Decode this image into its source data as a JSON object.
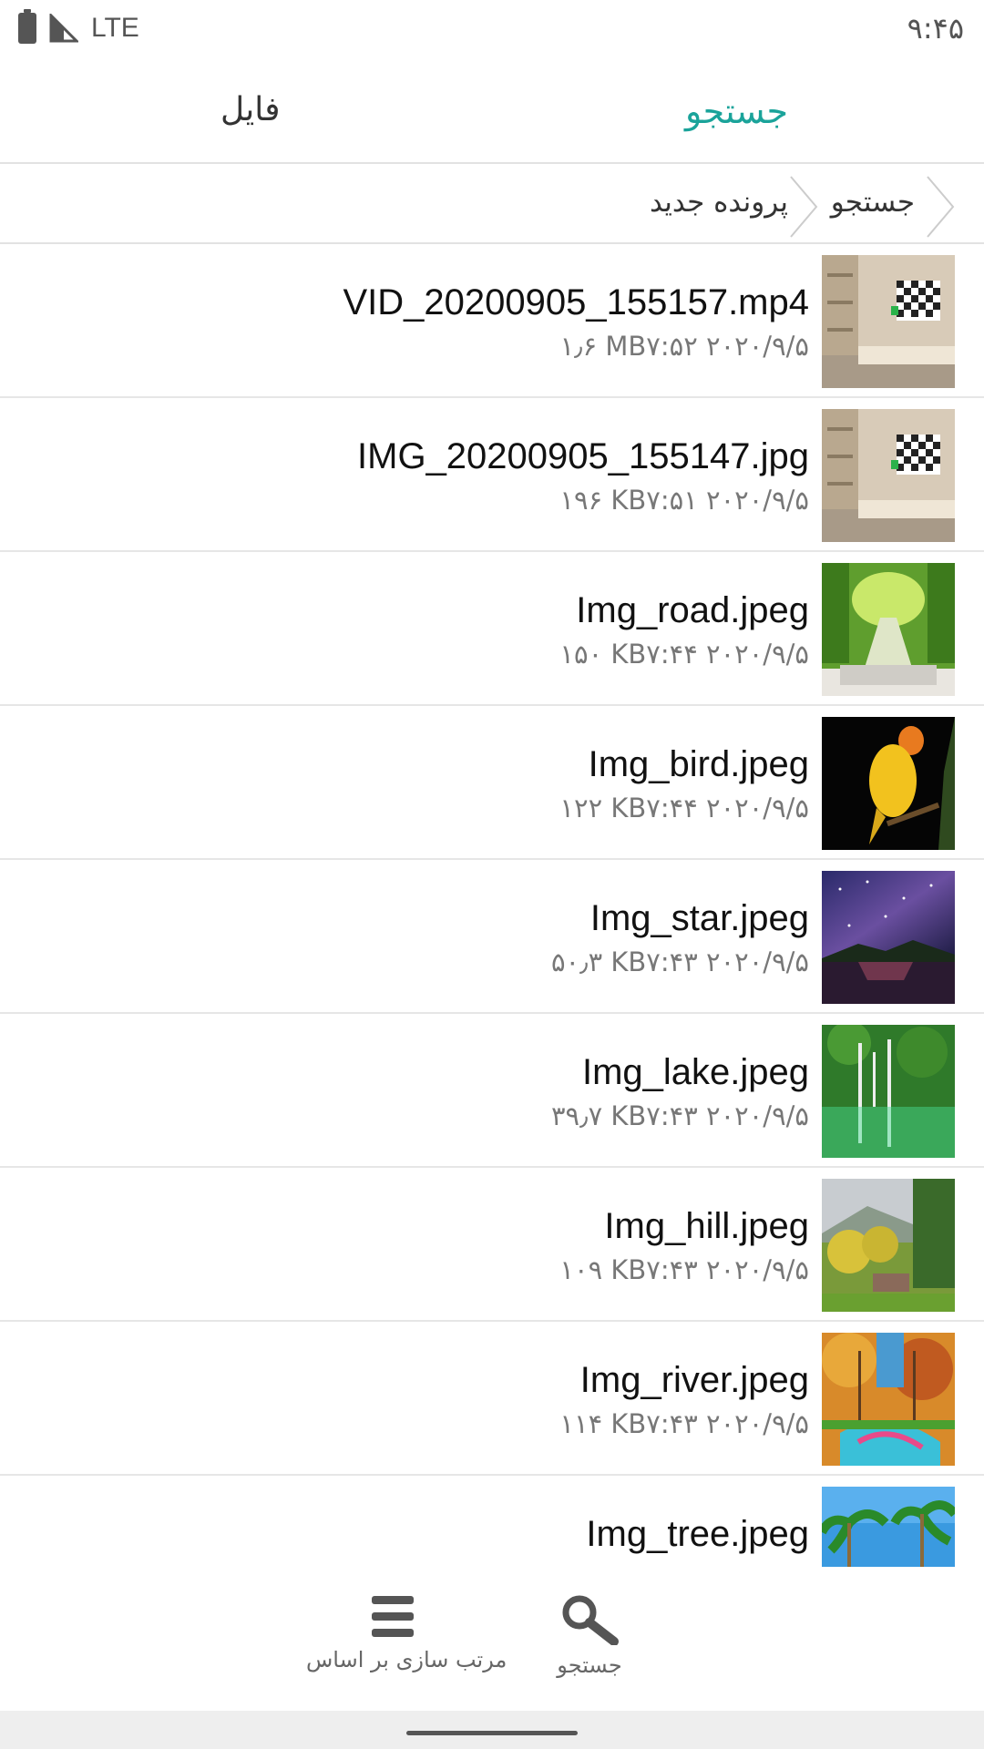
{
  "status_bar": {
    "network": "LTE",
    "time": "۹:۴۵",
    "icons": [
      "battery-icon",
      "signal-icon"
    ]
  },
  "tabs": [
    {
      "label": "جستجو",
      "active": true
    },
    {
      "label": "فایل",
      "active": false
    }
  ],
  "breadcrumb": {
    "items": [
      "جستجو",
      "پرونده جدید"
    ]
  },
  "files": [
    {
      "name": "VID_20200905_155157.mp4",
      "date": "۲۰۲۰/۹/۵",
      "time": "۷:۵۲",
      "size": "۱٫۶ MB",
      "thumb": "room-video-thumbnail"
    },
    {
      "name": "IMG_20200905_155147.jpg",
      "date": "۲۰۲۰/۹/۵",
      "time": "۷:۵۱",
      "size": "۱۹۶ KB",
      "thumb": "room-photo-thumbnail"
    },
    {
      "name": "Img_road.jpeg",
      "date": "۲۰۲۰/۹/۵",
      "time": "۷:۴۴",
      "size": "۱۵۰ KB",
      "thumb": "road-thumbnail"
    },
    {
      "name": "Img_bird.jpeg",
      "date": "۲۰۲۰/۹/۵",
      "time": "۷:۴۴",
      "size": "۱۲۲ KB",
      "thumb": "bird-thumbnail"
    },
    {
      "name": "Img_star.jpeg",
      "date": "۲۰۲۰/۹/۵",
      "time": "۷:۴۳",
      "size": "۵۰٫۳ KB",
      "thumb": "star-thumbnail"
    },
    {
      "name": "Img_lake.jpeg",
      "date": "۲۰۲۰/۹/۵",
      "time": "۷:۴۳",
      "size": "۳۹٫۷ KB",
      "thumb": "lake-thumbnail"
    },
    {
      "name": "Img_hill.jpeg",
      "date": "۲۰۲۰/۹/۵",
      "time": "۷:۴۳",
      "size": "۱۰۹ KB",
      "thumb": "hill-thumbnail"
    },
    {
      "name": "Img_river.jpeg",
      "date": "۲۰۲۰/۹/۵",
      "time": "۷:۴۳",
      "size": "۱۱۴ KB",
      "thumb": "river-thumbnail"
    },
    {
      "name": "Img_tree.jpeg",
      "date": "",
      "time": "",
      "size": "",
      "thumb": "tree-thumbnail"
    }
  ],
  "bottom_bar": {
    "search_label": "جستجو",
    "sort_label": "مرتب سازی بر اساس",
    "search_icon": "search-icon",
    "sort_icon": "menu-icon"
  },
  "colors": {
    "accent": "#1aa39a",
    "divider": "#e2e2e2"
  }
}
